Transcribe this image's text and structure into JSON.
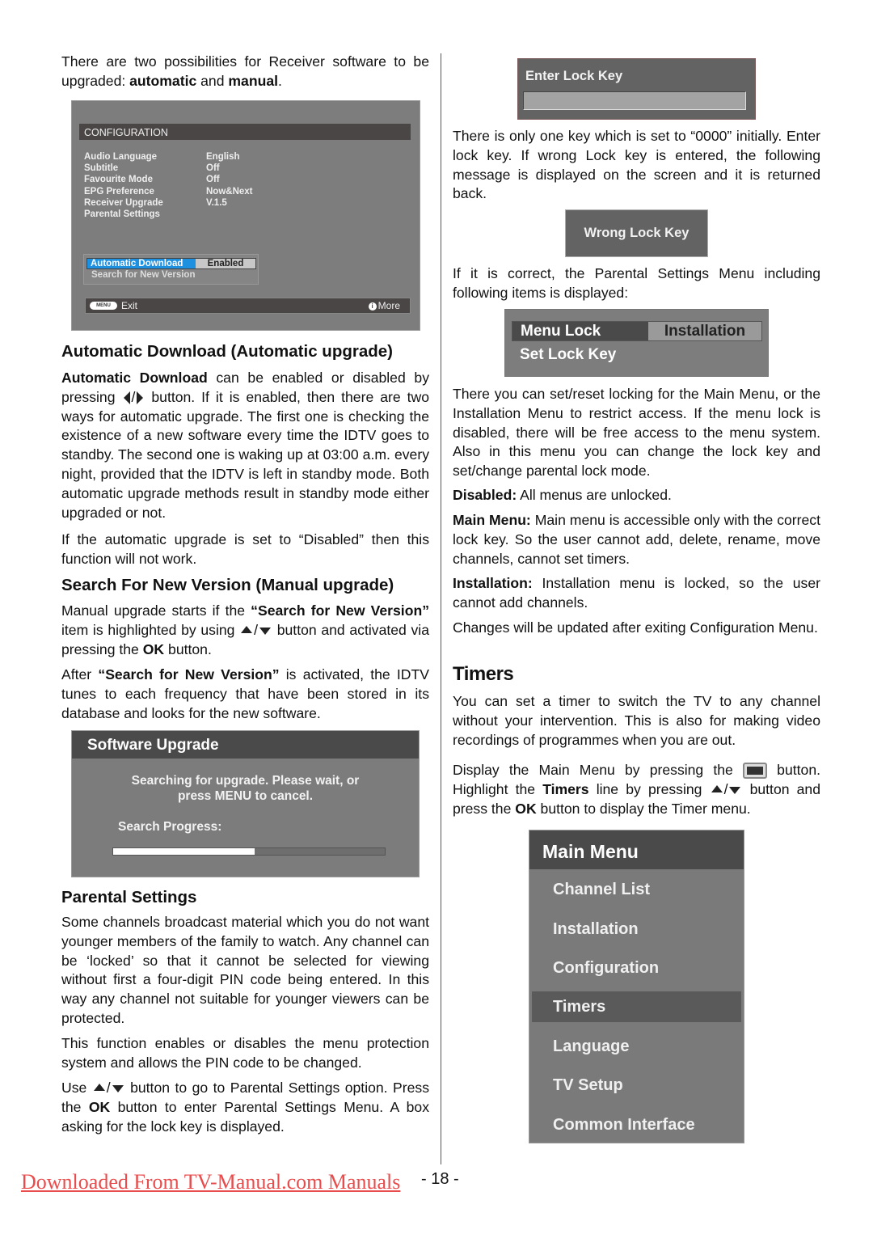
{
  "page": {
    "intro": {
      "t1": "There are two possibilities for Receiver software to be upgraded: ",
      "b1": "automatic",
      "t2": " and ",
      "b2": "manual",
      "t3": "."
    },
    "config_screen": {
      "title": "CONFIGURATION",
      "rows": [
        {
          "label": "Audio Language",
          "value": "English"
        },
        {
          "label": "Subtitle",
          "value": "Off"
        },
        {
          "label": "Favourite Mode",
          "value": "Off"
        },
        {
          "label": "EPG Preference",
          "value": "Now&Next"
        },
        {
          "label": "Receiver Upgrade",
          "value": "V.1.5"
        },
        {
          "label": "Parental Settings",
          "value": ""
        }
      ],
      "submenu": {
        "highlighted_label": "Automatic Download",
        "highlighted_value": "Enabled",
        "second_item": "Search for New Version"
      },
      "footer": {
        "menu_key": "MENU",
        "exit": "Exit",
        "more": "More",
        "info_glyph": "i"
      }
    },
    "auto_download": {
      "heading": "Automatic Download (Automatic upgrade)",
      "p1_bold": "Automatic Download",
      "p1_a": " can be enabled or disabled by pressing ",
      "p1_b": " button. If it is enabled, then there are two ways for automatic upgrade. The first one is checking the existence of a new software every time the IDTV goes to standby. The second one is waking up at 03:00 a.m. every night, provided that the IDTV is left in standby mode. Both automatic upgrade methods result in standby mode either upgraded or not.",
      "p2": "If the automatic upgrade is set to “Disabled” then this function will not work."
    },
    "manual_upgrade": {
      "heading": "Search For New Version (Manual upgrade)",
      "p1_a": "Manual upgrade starts if the ",
      "p1_bold": "“Search for New Version”",
      "p1_b": " item is highlighted by using ",
      "p1_c": " button and activated via pressing the ",
      "p1_ok": "OK",
      "p1_d": " button.",
      "p2_a": "After ",
      "p2_bold": "“Search for New Version”",
      "p2_b": " is activated, the IDTV tunes to each frequency that have been stored in its database and looks for the new software."
    },
    "software_upgrade_screen": {
      "title": "Software Upgrade",
      "message_line1": "Searching for upgrade. Please wait, or",
      "message_line2": "press MENU to cancel.",
      "progress_label": "Search Progress:",
      "progress_percent": 52
    },
    "parental": {
      "heading": "Parental Settings",
      "p1": "Some channels broadcast material which you do not want younger members of the family to watch. Any channel can be ‘locked’ so that it cannot be selected for viewing without first a four-digit PIN code being entered. In this way any channel not suitable for younger viewers can be protected.",
      "p2": "This function enables or disables the menu protection system and allows the PIN code to be changed.",
      "p3_a": "Use ",
      "p3_b": " button  to go to Parental Settings option. Press the ",
      "p3_ok": "OK",
      "p3_c": " button to enter Parental Settings Menu. A box asking for the lock key is displayed."
    },
    "lock_key_screen": {
      "title": "Enter Lock Key",
      "input_value": ""
    },
    "lock_key_text": "There is only one key which is set to “0000” initially. Enter lock key. If wrong Lock key is entered, the following message is displayed on the screen and it is returned back.",
    "wrong_key_screen": {
      "message": "Wrong Lock Key"
    },
    "correct_text": "If it is correct, the Parental Settings Menu including following items is displayed:",
    "parental_menu_screen": {
      "item1_label": "Menu Lock",
      "item1_value": "Installation",
      "item2_label": "Set Lock Key"
    },
    "parental_desc": "There you can set/reset locking for the Main Menu, or the Installation Menu to restrict access. If the menu lock is disabled, there will be free access to the menu system. Also in this menu you can change the lock key and set/change parental lock mode.",
    "modes": [
      {
        "bold": "Disabled:",
        "text": " All menus are unlocked."
      },
      {
        "bold": "Main Menu:",
        "text": " Main menu is accessible only with the correct lock key. So the user cannot add, delete, rename, move channels, cannot set timers."
      },
      {
        "bold": "Installation:",
        "text": " Installation menu is locked, so the user cannot add channels."
      }
    ],
    "changes_text": "Changes will be updated after exiting Configuration Menu.",
    "timers": {
      "heading": "Timers",
      "p1": "You can set a timer to switch the TV to any channel without your intervention. This is also for making video recordings of programmes when you are out.",
      "p2_a": "Display the Main Menu by pressing the ",
      "p2_b": " button. Highlight the ",
      "p2_bold": "Timers",
      "p2_c": " line by pressing ",
      "p2_d": " button and press the ",
      "p2_ok": "OK",
      "p2_e": " button to display the Timer menu."
    },
    "main_menu_screen": {
      "title": "Main Menu",
      "items": [
        "Channel List",
        "Installation",
        "Configuration",
        "Timers",
        "Language",
        "TV Setup",
        "Common Interface"
      ],
      "selected": "Timers"
    },
    "footer": {
      "link_text": "Downloaded From TV-Manual.com Manuals",
      "page_number": "- 18 -"
    }
  }
}
